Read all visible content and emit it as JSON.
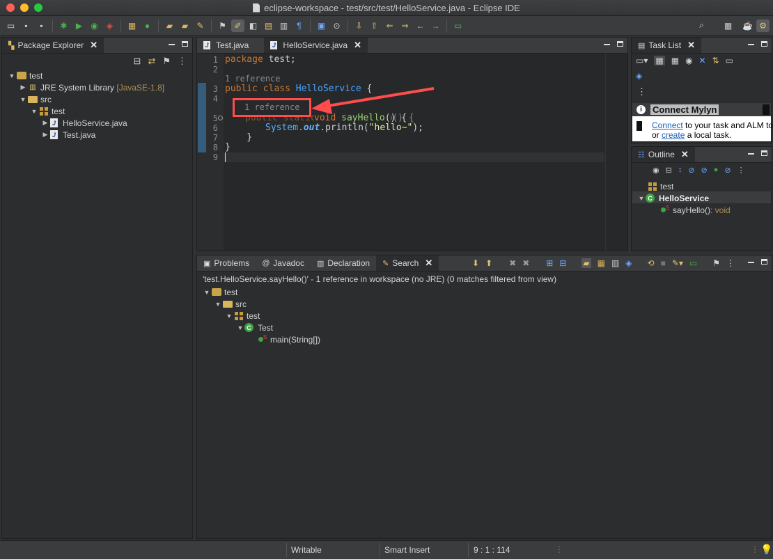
{
  "window": {
    "title": "eclipse-workspace - test/src/test/HelloService.java - Eclipse IDE"
  },
  "package_explorer": {
    "tab_label": "Package Explorer",
    "tree": [
      {
        "label": "test",
        "icon": "project-icon",
        "level": 0,
        "expanded": true
      },
      {
        "label": "JRE System Library",
        "suffix": "[JavaSE-1.8]",
        "icon": "library-icon",
        "level": 1,
        "expanded": false
      },
      {
        "label": "src",
        "icon": "folder-icon",
        "level": 1,
        "expanded": true
      },
      {
        "label": "test",
        "icon": "package-icon",
        "level": 2,
        "expanded": true
      },
      {
        "label": "HelloService.java",
        "icon": "java-file-icon",
        "level": 3,
        "expanded": false
      },
      {
        "label": "Test.java",
        "icon": "java-file-icon",
        "level": 3,
        "expanded": false
      }
    ]
  },
  "editor": {
    "tabs": [
      {
        "label": "Test.java",
        "selected": false
      },
      {
        "label": "HelloService.java",
        "selected": true
      }
    ],
    "line_numbers": [
      "1",
      "2",
      "3",
      "4",
      "5",
      "6",
      "7",
      "8",
      "9"
    ],
    "code": {
      "line1_kw": "package",
      "line1_rest": " test;",
      "codevision_class": "1 reference",
      "line3_kw": "public class ",
      "line3_cls": "HelloService",
      "line3_rest": " {",
      "codevision_method": "1 reference",
      "line5_kw": "public static void ",
      "line5_mth": "sayHello",
      "line5_rest": "() {",
      "line6_sys": "System.",
      "line6_fld": "out",
      "line6_call": ".println(",
      "line6_str": "\"hello~\"",
      "line6_end": ");",
      "line7": "    }",
      "line8": "}"
    },
    "highlight_color": "#ff4d4d"
  },
  "task_list": {
    "tab_label": "Task List",
    "mylyn_title": "Connect Mylyn",
    "mylyn_connect": "Connect",
    "mylyn_text1": " to your task and ALM to",
    "mylyn_or": "or ",
    "mylyn_create": "create",
    "mylyn_text2": " a local task."
  },
  "outline": {
    "tab_label": "Outline",
    "items": [
      {
        "label": "test",
        "icon": "package-icon"
      },
      {
        "label": "HelloService",
        "icon": "class-icon"
      },
      {
        "label": "sayHello()",
        "type": " : void",
        "icon": "method-icon"
      }
    ]
  },
  "bottom": {
    "tabs": [
      {
        "label": "Problems",
        "icon": "problems-icon",
        "selected": false
      },
      {
        "label": "Javadoc",
        "icon": "at-icon",
        "selected": false
      },
      {
        "label": "Declaration",
        "icon": "declaration-icon",
        "selected": false
      },
      {
        "label": "Search",
        "icon": "search-flashlight-icon",
        "selected": true
      }
    ],
    "search_summary": "'test.HelloService.sayHello()' - 1 reference in workspace (no JRE) (0 matches filtered from view)",
    "tree": [
      {
        "label": "test",
        "icon": "project-icon",
        "level": 0
      },
      {
        "label": "src",
        "icon": "folder-icon",
        "level": 1
      },
      {
        "label": "test",
        "icon": "package-icon",
        "level": 2
      },
      {
        "label": "Test",
        "icon": "class-icon",
        "level": 3
      },
      {
        "label": "main(String[])",
        "icon": "method-icon",
        "level": 4
      }
    ]
  },
  "statusbar": {
    "writable": "Writable",
    "insert_mode": "Smart Insert",
    "position": "9 : 1 : 114"
  }
}
